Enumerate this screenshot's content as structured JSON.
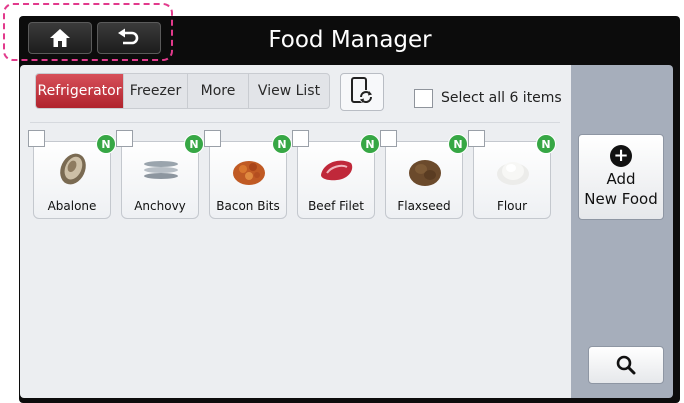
{
  "header": {
    "title": "Food Manager",
    "home_icon": "home-icon",
    "back_icon": "back-arrow-icon"
  },
  "tabs": [
    {
      "label": "Refrigerator",
      "active": true
    },
    {
      "label": "Freezer",
      "active": false
    },
    {
      "label": "More",
      "active": false
    },
    {
      "label": "View List",
      "active": false
    }
  ],
  "sync_icon": "phone-sync-icon",
  "select_all": {
    "label": "Select all 6 items",
    "checked": false
  },
  "foods": [
    {
      "name": "Abalone",
      "badge": "N",
      "icon": "abalone-icon"
    },
    {
      "name": "Anchovy",
      "badge": "N",
      "icon": "anchovy-icon"
    },
    {
      "name": "Bacon Bits",
      "badge": "N",
      "icon": "bacon-bits-icon"
    },
    {
      "name": "Beef Filet",
      "badge": "N",
      "icon": "beef-filet-icon"
    },
    {
      "name": "Flaxseed",
      "badge": "N",
      "icon": "flaxseed-icon"
    },
    {
      "name": "Flour",
      "badge": "N",
      "icon": "flour-icon"
    }
  ],
  "add_button": {
    "line1": "Add",
    "line2": "New Food",
    "icon": "plus-circle-icon"
  },
  "search_icon": "search-icon",
  "colors": {
    "active_tab": "#c0323c",
    "badge": "#37a745",
    "highlight": "#e23a8c",
    "sidebar": "#a6aebb"
  }
}
